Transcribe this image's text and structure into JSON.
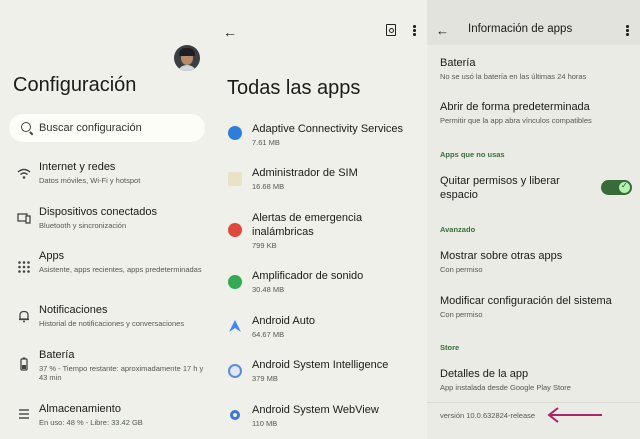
{
  "settings": {
    "title": "Configuración",
    "search_placeholder": "Buscar configuración",
    "items": [
      {
        "icon": "wifi-icon",
        "title": "Internet y redes",
        "subtitle": "Datos móviles, Wi-Fi y hotspot"
      },
      {
        "icon": "devices-icon",
        "title": "Dispositivos conectados",
        "subtitle": "Bluetooth y sincronización"
      },
      {
        "icon": "apps-grid-icon",
        "title": "Apps",
        "subtitle": "Asistente, apps recientes, apps predeterminadas"
      },
      {
        "icon": "bell-icon",
        "title": "Notificaciones",
        "subtitle": "Historial de notificaciones y conversaciones"
      },
      {
        "icon": "battery-icon",
        "title": "Batería",
        "subtitle": "37 % - Tiempo restante: aproximadamente 17 h y 43 min"
      },
      {
        "icon": "storage-icon",
        "title": "Almacenamiento",
        "subtitle": "En uso: 48 % - Libre: 33.42 GB"
      }
    ]
  },
  "all_apps": {
    "title": "Todas las apps",
    "apps": [
      {
        "name": "Adaptive Connectivity Services",
        "size": "7.61 MB",
        "color": "#2f7ddb"
      },
      {
        "name": "Administrador de SIM",
        "size": "16.68 MB",
        "color": "#e8e2c9"
      },
      {
        "name": "Alertas de emergencia inalámbricas",
        "size": "799 KB",
        "color": "#e0483d"
      },
      {
        "name": "Amplificador de sonido",
        "size": "30.48 MB",
        "color": "#35a853"
      },
      {
        "name": "Android Auto",
        "size": "64.67 MB",
        "color": "#4285f4"
      },
      {
        "name": "Android System Intelligence",
        "size": "379 MB",
        "color": "#5b8bd8"
      },
      {
        "name": "Android System WebView",
        "size": "110 MB",
        "color": "#3b78d8"
      }
    ]
  },
  "app_info": {
    "title": "Información de apps",
    "battery_title": "Batería",
    "battery_sub": "No se usó la batería en las últimas 24 horas",
    "default_title": "Abrir de forma predeterminada",
    "default_sub": "Permitir que la app abra vínculos compatibles",
    "unused_header": "Apps que no usas",
    "remove_perms": "Quitar permisos y liberar espacio",
    "advanced_header": "Avanzado",
    "overlay_title": "Mostrar sobre otras apps",
    "overlay_sub": "Con permiso",
    "modify_title": "Modificar configuración del sistema",
    "modify_sub": "Con permiso",
    "store_header": "Store",
    "details_title": "Detalles de la app",
    "details_sub": "App instalada desde Google Play Store",
    "version": "versión 10.0.632824-release",
    "accent": "#386a3a"
  }
}
